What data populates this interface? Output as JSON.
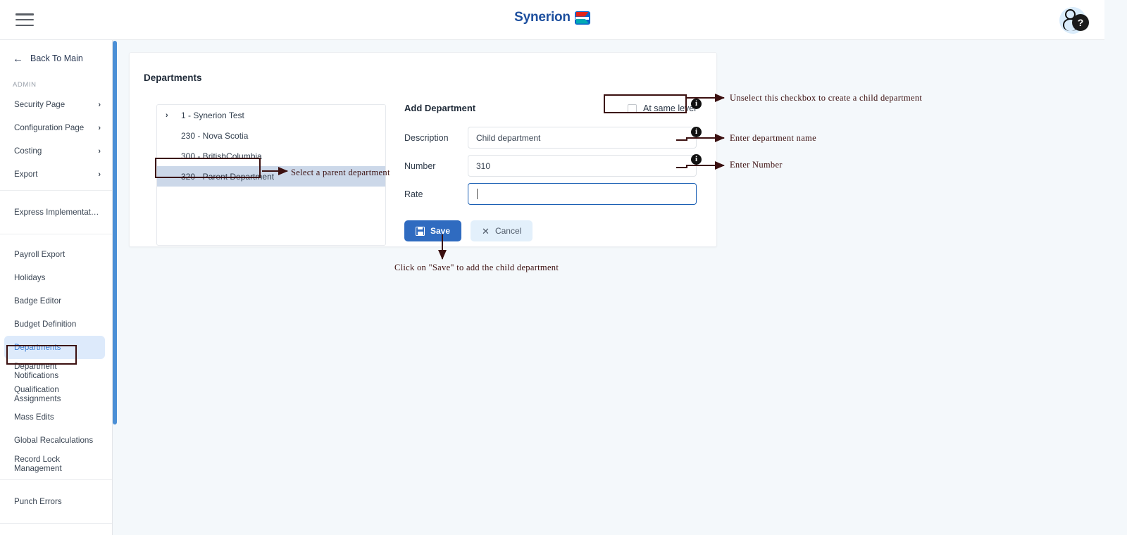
{
  "topbar": {
    "menu_icon": "hamburger-icon",
    "brand_name": "Synerion",
    "help_icon": "question-mark-icon",
    "avatar_icon": "user-avatar-icon"
  },
  "sidebar": {
    "back_label": "Back To Main",
    "section_label": "ADMIN",
    "groups": [
      {
        "items": [
          {
            "label": "Security Page",
            "chevron": "›",
            "active": false
          },
          {
            "label": "Configuration Page",
            "chevron": "›",
            "active": false
          },
          {
            "label": "Costing",
            "chevron": "›",
            "active": false
          },
          {
            "label": "Export",
            "chevron": "›",
            "active": false
          }
        ]
      },
      {
        "items": [
          {
            "label": "Express Implementation P...",
            "active": false
          }
        ]
      },
      {
        "items": [
          {
            "label": "Payroll Export",
            "active": false
          },
          {
            "label": "Holidays",
            "active": false
          },
          {
            "label": "Badge Editor",
            "active": false
          },
          {
            "label": "Budget Definition",
            "active": false
          },
          {
            "label": "Departments",
            "active": true
          },
          {
            "label": "Department Notifications",
            "active": false
          },
          {
            "label": "Qualification Assignments",
            "active": false
          },
          {
            "label": "Mass Edits",
            "active": false
          },
          {
            "label": "Global Recalculations",
            "active": false
          },
          {
            "label": "Record Lock Management",
            "active": false
          }
        ]
      },
      {
        "items": [
          {
            "label": "Punch Errors",
            "active": false
          }
        ]
      }
    ]
  },
  "main": {
    "card_title": "Departments",
    "tree": {
      "rows": [
        {
          "label": "1 - Synerion Test",
          "chevron": "›",
          "selected": false
        },
        {
          "label": "230 - Nova Scotia",
          "chevron": "",
          "selected": false
        },
        {
          "label": "300 - BritishColumbia",
          "chevron": "",
          "selected": false
        },
        {
          "label": "320 - Parent Department",
          "chevron": "",
          "selected": true
        }
      ]
    },
    "form": {
      "title": "Add Department",
      "checkbox_label": "At same level",
      "checkbox_checked": false,
      "fields": [
        {
          "label": "Description",
          "value": "Child department",
          "focused": false
        },
        {
          "label": "Number",
          "value": "310",
          "focused": false
        },
        {
          "label": "Rate",
          "value": "",
          "focused": true
        }
      ],
      "save_label": "Save",
      "cancel_label": "Cancel",
      "save_icon": "floppy-disk-icon",
      "cancel_icon": "close-x-icon"
    }
  },
  "annotations": {
    "checkbox_note": "Unselect this checkbox to create a child department",
    "description_note": "Enter department name",
    "number_note": "Enter Number",
    "tree_note": "Select a parent department",
    "save_note": "Click on \"Save\" to add the child department",
    "info_badge": "i",
    "accent_color": "#3b1010"
  }
}
